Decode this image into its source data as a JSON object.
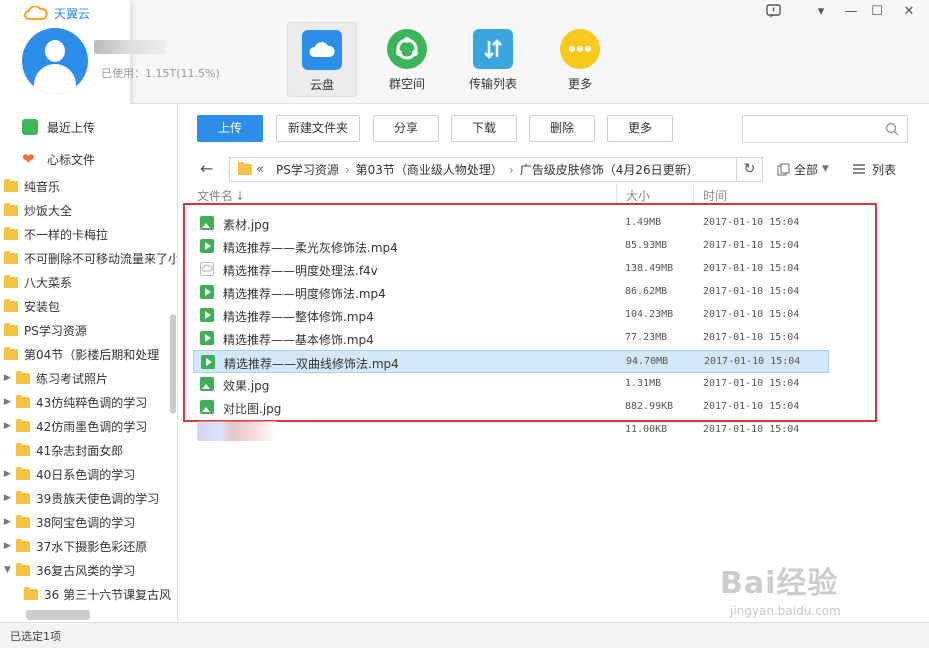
{
  "app": {
    "brand": "天翼云",
    "storage_used": "已使用：1.15T(11.5%)"
  },
  "nav": [
    {
      "label": "云盘",
      "icon": "cloud-disk-icon",
      "active": true
    },
    {
      "label": "群空间",
      "icon": "group-space-icon",
      "active": false
    },
    {
      "label": "传输列表",
      "icon": "transfer-list-icon",
      "active": false
    },
    {
      "label": "更多",
      "icon": "more-icon",
      "active": false
    }
  ],
  "sidebar": {
    "quick": [
      {
        "label": "最近上传",
        "icon": "recent-upload-icon"
      },
      {
        "label": "心标文件",
        "icon": "heart-icon"
      }
    ],
    "tree": [
      {
        "label": "纯音乐",
        "level": 0,
        "expand": ""
      },
      {
        "label": "炒饭大全",
        "level": 0,
        "expand": ""
      },
      {
        "label": "不一样的卡梅拉",
        "level": 0,
        "expand": ""
      },
      {
        "label": "不可删除不可移动流量来了小",
        "level": 0,
        "expand": ""
      },
      {
        "label": "八大菜系",
        "level": 0,
        "expand": ""
      },
      {
        "label": "安装包",
        "level": 0,
        "expand": ""
      },
      {
        "label": "PS学习资源",
        "level": 0,
        "expand": ""
      },
      {
        "label": "第04节（影楼后期和处理",
        "level": 1,
        "expand": ""
      },
      {
        "label": "练习考试照片",
        "level": 2,
        "expand": "▶"
      },
      {
        "label": "43仿纯粹色调的学习",
        "level": 2,
        "expand": "▶"
      },
      {
        "label": "42仿雨墨色调的学习",
        "level": 2,
        "expand": "▶"
      },
      {
        "label": "41杂志封面女郎",
        "level": 2,
        "expand": ""
      },
      {
        "label": "40日系色调的学习",
        "level": 2,
        "expand": "▶"
      },
      {
        "label": "39贵族天使色调的学习",
        "level": 2,
        "expand": "▶"
      },
      {
        "label": "38阿宝色调的学习",
        "level": 2,
        "expand": "▶"
      },
      {
        "label": "37水下摄影色彩还原",
        "level": 2,
        "expand": "▶"
      },
      {
        "label": "36复古风类的学习",
        "level": 2,
        "expand": "▼"
      },
      {
        "label": "36 第三十六节课复古风",
        "level": 3,
        "expand": ""
      }
    ]
  },
  "toolbar": {
    "upload": "上传",
    "new_folder": "新建文件夹",
    "share": "分享",
    "download": "下载",
    "delete": "删除",
    "more": "更多",
    "search_placeholder": ""
  },
  "path": {
    "prefix": "«",
    "segments": [
      "PS学习资源",
      "第03节（商业级人物处理）",
      "广告级皮肤修饰（4月26日更新）"
    ],
    "separator": "›",
    "filter_label": "全部",
    "view_label": "列表"
  },
  "columns": {
    "name": "文件名",
    "name_sort": "↓",
    "size": "大小",
    "time": "时间"
  },
  "files": [
    {
      "name": "素材.jpg",
      "size": "1.49MB",
      "time": "2017-01-10 15:04",
      "type": "image",
      "selected": false
    },
    {
      "name": "精选推荐——柔光灰修饰法.mp4",
      "size": "85.93MB",
      "time": "2017-01-10 15:04",
      "type": "video",
      "selected": false
    },
    {
      "name": "精选推荐——明度处理法.f4v",
      "size": "138.49MB",
      "time": "2017-01-10 15:04",
      "type": "generic",
      "selected": false
    },
    {
      "name": "精选推荐——明度修饰法.mp4",
      "size": "86.62MB",
      "time": "2017-01-10 15:04",
      "type": "video",
      "selected": false
    },
    {
      "name": "精选推荐——整体修饰.mp4",
      "size": "104.23MB",
      "time": "2017-01-10 15:04",
      "type": "video",
      "selected": false
    },
    {
      "name": "精选推荐——基本修饰.mp4",
      "size": "77.23MB",
      "time": "2017-01-10 15:04",
      "type": "video",
      "selected": false
    },
    {
      "name": "精选推荐——双曲线修饰法.mp4",
      "size": "94.70MB",
      "time": "2017-01-10 15:04",
      "type": "video",
      "selected": true
    },
    {
      "name": "效果.jpg",
      "size": "1.31MB",
      "time": "2017-01-10 15:04",
      "type": "image",
      "selected": false
    },
    {
      "name": "对比图.jpg",
      "size": "882.99KB",
      "time": "2017-01-10 15:04",
      "type": "image",
      "selected": false
    },
    {
      "name": "",
      "size": "11.00KB",
      "time": "2017-01-10 15:04",
      "type": "blurred",
      "selected": false
    }
  ],
  "status": {
    "text": "已选定1项"
  },
  "watermark": {
    "brand": "Bai经验",
    "url": "jingyan.baidu.com"
  },
  "colors": {
    "accent": "#2d8ee9",
    "highlight_border": "#d9373d",
    "file_green": "#3fae55",
    "folder": "#f5c342",
    "selected_row": "#d4e8fb"
  }
}
